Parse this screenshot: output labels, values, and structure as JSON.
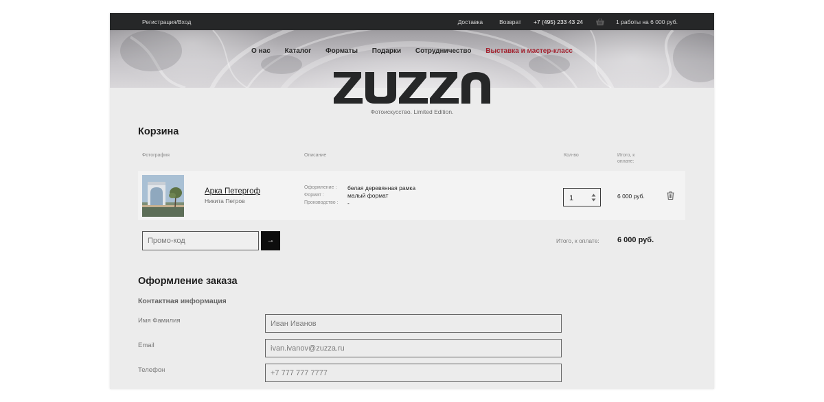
{
  "topbar": {
    "login": "Регистрация/Вход",
    "delivery": "Доставка",
    "returns": "Возврат",
    "phone": "+7 (495) 233 43 24",
    "cart_summary": "1 работы на 6 000 руб."
  },
  "nav": {
    "items": [
      "О нас",
      "Каталог",
      "Форматы",
      "Подарки",
      "Сотрудничество",
      "Выставка и мастер-класс"
    ],
    "accent_color": "#a3222f"
  },
  "brand": {
    "logo_text": "ZUZZA",
    "tagline": "Фотоискусство. Limited Edition."
  },
  "cart": {
    "title": "Корзина",
    "headers": {
      "photo": "Фотография",
      "description": "Описание",
      "qty": "Кол-во",
      "total_l1": "Итого, к",
      "total_l2": "оплате:"
    },
    "item": {
      "title": "Арка Петергоф",
      "author": "Никита Петров",
      "props": [
        {
          "label": "Оформление :",
          "value": "белая деревянная рамка"
        },
        {
          "label": "Формат :",
          "value": "малый формат"
        },
        {
          "label": "Производство :",
          "value": "-"
        }
      ],
      "qty": "1",
      "sum": "6 000 руб."
    },
    "promo_placeholder": "Промо-код",
    "promo_button": "→",
    "total_label": "Итого, к оплате:",
    "total_value": "6 000 руб."
  },
  "checkout": {
    "title": "Оформление заказа",
    "section": "Контактная информация",
    "fields": [
      {
        "label": "Имя Фамилия",
        "placeholder": "Иван Иванов"
      },
      {
        "label": "Email",
        "placeholder": "ivan.ivanov@zuzza.ru"
      },
      {
        "label": "Телефон",
        "placeholder": "+7 777 777 7777"
      }
    ]
  },
  "icons": {
    "cart": "basket-icon",
    "qty": "updown-arrows-icon",
    "delete": "trash-icon"
  }
}
